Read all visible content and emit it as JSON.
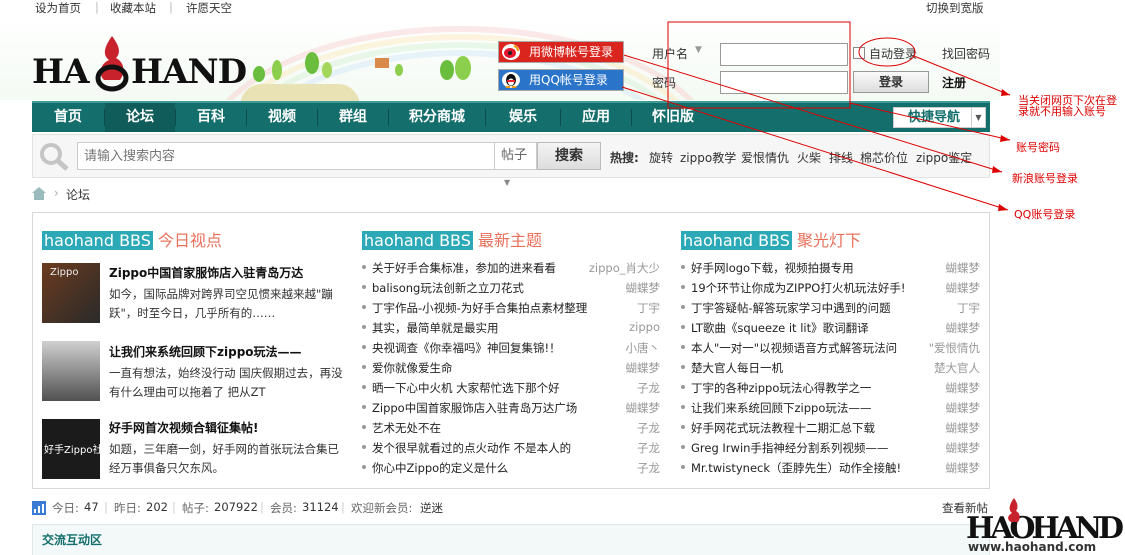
{
  "topbar": {
    "set_home": "设为首页",
    "favorite": "收藏本站",
    "wish_wall": "许愿天空",
    "wide_version": "切换到宽版"
  },
  "header": {
    "logo_text_left": "HA",
    "logo_text_right": "HAND"
  },
  "login": {
    "weibo_button": "用微博帐号登录",
    "qq_button": "用QQ帐号登录",
    "username_label": "用户名",
    "username_value": "",
    "password_label": "密码",
    "password_value": "",
    "auto_login": "自动登录",
    "forgot_password": "找回密码",
    "login_button": "登录",
    "register": "注册"
  },
  "nav": {
    "items": [
      "首页",
      "论坛",
      "百科",
      "视频",
      "群组",
      "积分商城",
      "娱乐",
      "应用",
      "怀旧版"
    ],
    "active_index": 1,
    "quick_nav": "快捷导航"
  },
  "search": {
    "placeholder": "请输入搜索内容",
    "scope": "帖子",
    "button": "搜索",
    "hot_label": "热搜:",
    "hot_terms": [
      "旋转",
      "zippo教学",
      "爱恨情仇",
      "火柴",
      "排线",
      "棉芯价位",
      "zippo鉴定"
    ]
  },
  "breadcrumb": {
    "current": "论坛"
  },
  "columns": {
    "bbs_tag": "haohand BBS",
    "today": {
      "title": "今日视点",
      "features": [
        {
          "title": "Zippo中国首家服饰店入驻青岛万达",
          "desc": "如今，国际品牌对跨界司空见惯来越来越\"蹦跃\"，时至今日，几乎所有的……",
          "thumb_text": "Zippo"
        },
        {
          "title": "让我们来系统回顾下zippo玩法——",
          "desc": "一直有想法，始终没行动 国庆假期过去，再没有什么理由可以拖着了 把从ZT",
          "thumb_text": ""
        },
        {
          "title": "好手网首次视频合辑征集帖!",
          "desc": "如题，三年磨一剑，好手网的首张玩法合集已经万事俱备只欠东风。",
          "thumb_text": "好手Zippo社区"
        }
      ]
    },
    "newest": {
      "title": "最新主题",
      "items": [
        {
          "t": "关于好手合集标准，参加的进来看看",
          "a": "zippo_肖大少"
        },
        {
          "t": "balisong玩法创新之立刀花式",
          "a": "蝴蝶梦"
        },
        {
          "t": "丁宇作品-小视频-为好手合集拍点素材整理",
          "a": "丁宇"
        },
        {
          "t": "其实，最简单就是最实用",
          "a": "zippo"
        },
        {
          "t": "央视调查《你幸福吗》神回复集锦!！",
          "a": "小唐丶"
        },
        {
          "t": "爱你就像爱生命",
          "a": "蝴蝶梦"
        },
        {
          "t": "晒一下心中火机 大家帮忙选下那个好",
          "a": "子龙"
        },
        {
          "t": "Zippo中国首家服饰店入驻青岛万达广场",
          "a": "蝴蝶梦"
        },
        {
          "t": "艺术无处不在",
          "a": "子龙"
        },
        {
          "t": "发个很早就看过的点火动作 不是本人的",
          "a": "子龙"
        },
        {
          "t": "你心中Zippo的定义是什么",
          "a": "子龙"
        }
      ]
    },
    "spotlight": {
      "title": "聚光灯下",
      "items": [
        {
          "t": "好手网logo下载，视频拍摄专用",
          "a": "蝴蝶梦"
        },
        {
          "t": "19个环节让你成为ZIPPO打火机玩法好手!",
          "a": "蝴蝶梦"
        },
        {
          "t": "丁宇答疑帖-解答玩家学习中遇到的问题",
          "a": "丁宇"
        },
        {
          "t": "LT歌曲《squeeze it lit》歌词翻译",
          "a": "蝴蝶梦"
        },
        {
          "t": "本人\"一对一\"以视频语音方式解答玩法问",
          "a": "\"爱恨情仇"
        },
        {
          "t": "楚大官人每日一机",
          "a": "楚大官人"
        },
        {
          "t": "丁宇的各种zippo玩法心得教学之一",
          "a": "蝴蝶梦"
        },
        {
          "t": "让我们来系统回顾下zippo玩法——",
          "a": "蝴蝶梦"
        },
        {
          "t": "好手网花式玩法教程十二期汇总下载",
          "a": "蝴蝶梦"
        },
        {
          "t": "Greg Irwin手指神经分割系列视频——",
          "a": "蝴蝶梦"
        },
        {
          "t": "Mr.twistyneck（歪脖先生）动作全接触!",
          "a": "蝴蝶梦"
        }
      ]
    }
  },
  "stats": {
    "today_label": "今日:",
    "today": "47",
    "yesterday_label": "昨日:",
    "yesterday": "202",
    "posts_label": "帖子:",
    "posts": "207922",
    "members_label": "会员:",
    "members": "31124",
    "welcome_label": "欢迎新会员:",
    "new_member": "逆迷",
    "view_new_posts": "查看新帖"
  },
  "section": {
    "title": "交流互动区"
  },
  "annotations": {
    "auto_login_note": "当关闭网页下次在登录就不用输入账号",
    "password_note": "账号密码",
    "weibo_note": "新浪账号登录",
    "qq_note": "QQ账号登录"
  },
  "watermark": {
    "logo": "HAOHAND",
    "url": "www.haohand.com"
  },
  "colors": {
    "nav": "#146f6c",
    "bbs_tag": "#2ba9b7",
    "section_title": "#e8705a",
    "annotation": "#dd0000"
  }
}
